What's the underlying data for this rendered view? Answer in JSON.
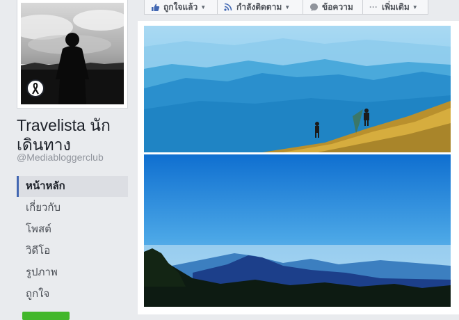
{
  "page": {
    "name": "Travelista นักเดินทาง",
    "handle": "@Mediabloggerclub"
  },
  "action_bar": {
    "like_label": "ถูกใจแล้ว",
    "follow_label": "กำลังติดตาม",
    "message_label": "ข้อความ",
    "more_label": "เพิ่มเติม"
  },
  "nav": {
    "items": [
      {
        "label": "หน้าหลัก",
        "active": true
      },
      {
        "label": "เกี่ยวกับ",
        "active": false
      },
      {
        "label": "โพสต์",
        "active": false
      },
      {
        "label": "วิดีโอ",
        "active": false
      },
      {
        "label": "รูปภาพ",
        "active": false
      },
      {
        "label": "ถูกใจ",
        "active": false
      }
    ]
  },
  "colors": {
    "accent": "#4267b2",
    "green_button": "#42b72a",
    "background": "#e9ebee"
  },
  "icons": {
    "like": "thumbs-up-icon",
    "follow": "rss-icon",
    "message": "chat-bubble-icon",
    "more": "ellipsis-icon",
    "badge": "black-ribbon-icon"
  }
}
